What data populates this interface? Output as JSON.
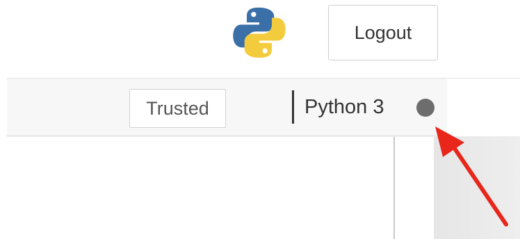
{
  "header": {
    "logo_icon": "python-logo-icon",
    "logout_label": "Logout"
  },
  "toolbar": {
    "trusted_label": "Trusted",
    "kernel_name": "Python 3",
    "kernel_status_icon": "kernel-idle-circle-icon"
  },
  "annotation": {
    "icon": "red-arrow-icon",
    "color": "#e8261a"
  },
  "colors": {
    "python_blue": "#3a6fa8",
    "python_yellow": "#f3cc3d",
    "kernel_indicator": "#6d6d6d",
    "toolbar_bg": "#f7f7f7"
  }
}
